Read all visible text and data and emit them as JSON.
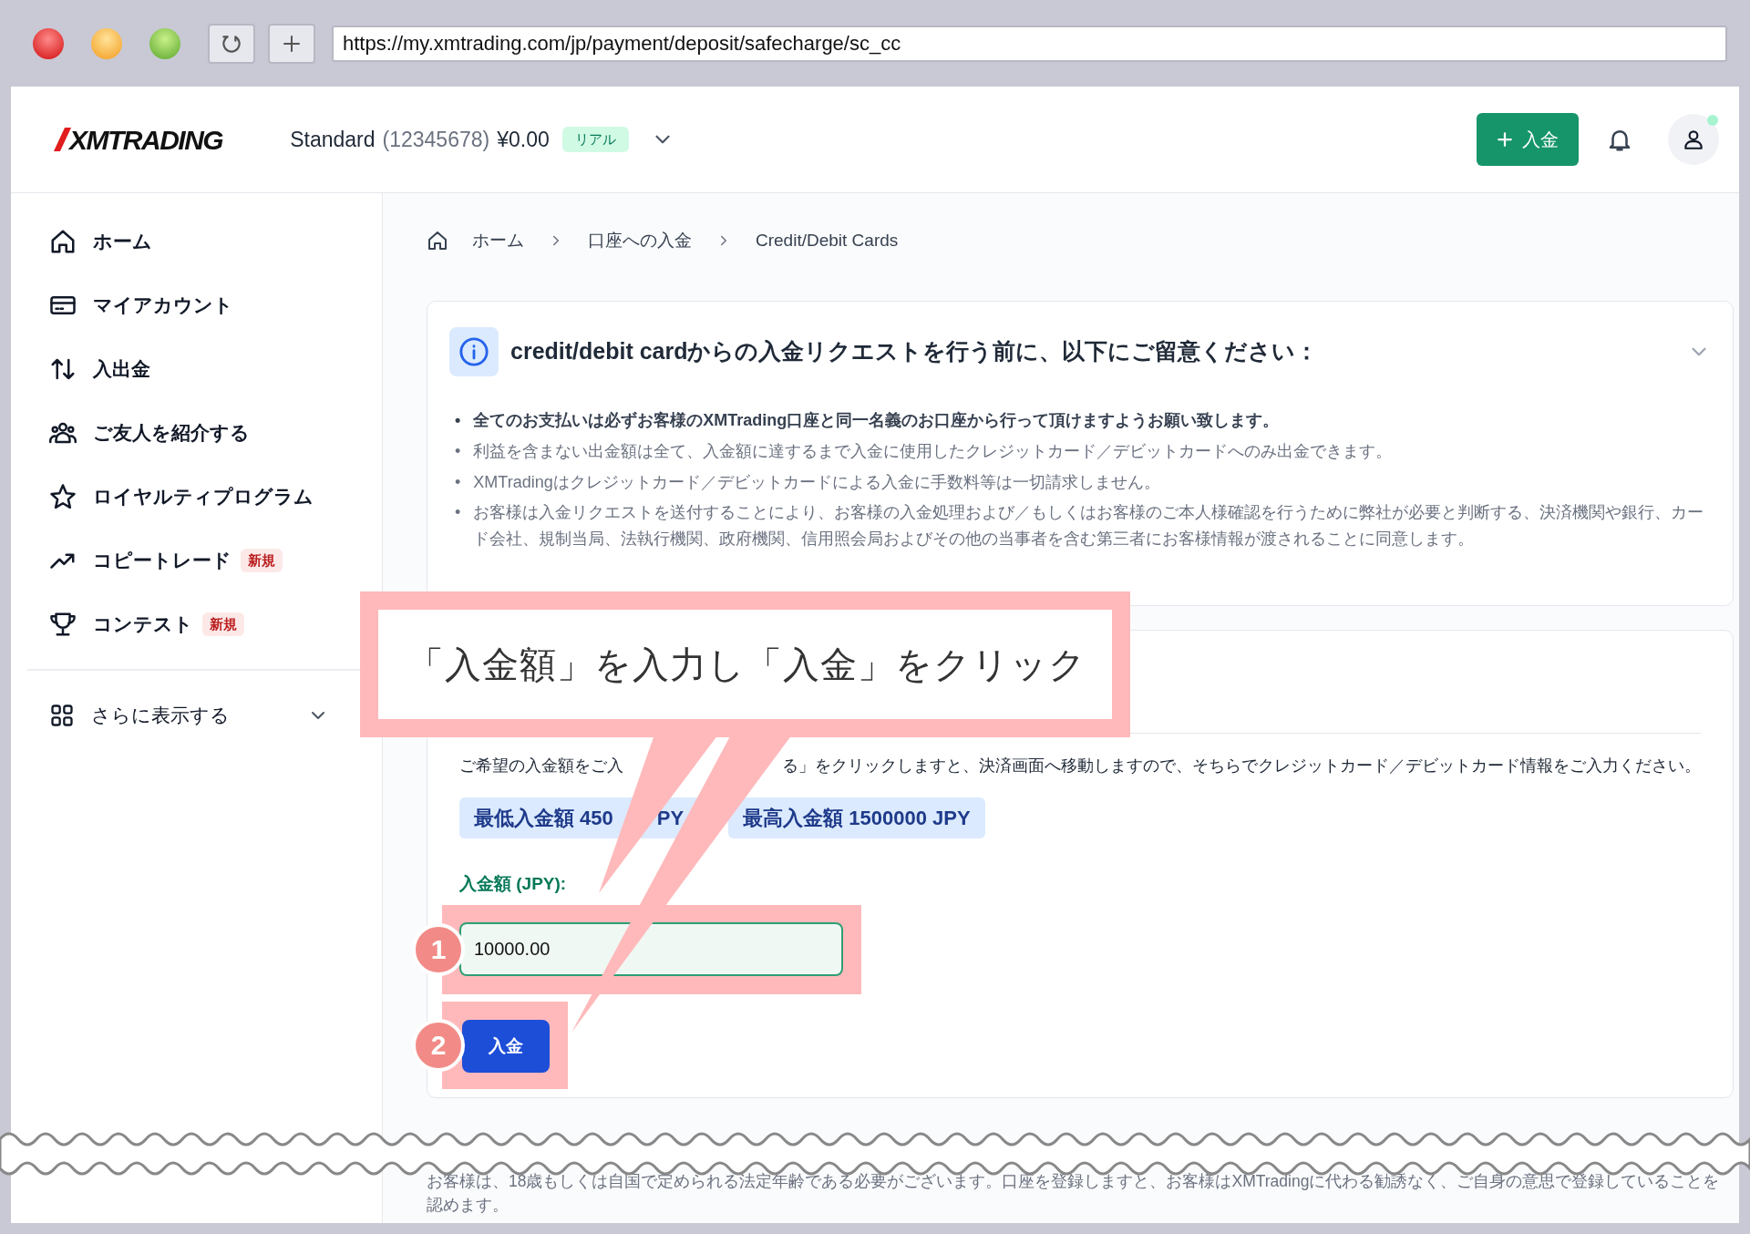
{
  "browser": {
    "url": "https://my.xmtrading.com/jp/payment/deposit/safecharge/sc_cc"
  },
  "header": {
    "logo": "XMTRADING",
    "account_type": "Standard",
    "account_number": "(12345678)",
    "balance": "¥0.00",
    "account_badge": "リアル",
    "deposit_button": "入金"
  },
  "sidebar": {
    "items": [
      {
        "label": "ホーム",
        "selected": false
      },
      {
        "label": "マイアカウント",
        "selected": false
      },
      {
        "label": "入出金",
        "selected": false
      },
      {
        "label": "ご友人を紹介する",
        "selected": false
      },
      {
        "label": "ロイヤルティプログラム",
        "selected": false
      },
      {
        "label": "コピートレード",
        "selected": false,
        "badge": "新規"
      },
      {
        "label": "コンテスト",
        "selected": false,
        "badge": "新規"
      }
    ],
    "more": {
      "label": "さらに表示する",
      "expanded": false
    }
  },
  "breadcrumb": [
    "ホーム",
    "口座への入金",
    "Credit/Debit Cards"
  ],
  "notice": {
    "title": "credit/debit cardからの入金リクエストを行う前に、以下にご留意ください：",
    "expanded": true,
    "items": [
      {
        "marker": "•",
        "text": "全てのお支払いは必ずお客様のXMTrading口座と同一名義のお口座から行って頂けますようお願い致します。",
        "bold": true
      },
      {
        "marker": "•",
        "text": "利益を含まない出金額は全て、入金額に達するまで入金に使用したクレジットカード／デビットカードへのみ出金できます。",
        "bold": false
      },
      {
        "marker": "•",
        "text": "XMTradingはクレジットカード／デビットカードによる入金に手数料等は一切請求しません。",
        "bold": false
      },
      {
        "marker": "•",
        "text": "お客様は入金リクエストを送付することにより、お客様の入金処理および／もしくはお客様のご本人様確認を行うために弊社が必要と判断する、決済機関や銀行、カード会社、規制当局、法執行機関、政府機関、信用照会局およびその他の当事者を含む第三者にお客様情報が渡されることに同意します。",
        "bold": false
      }
    ]
  },
  "deposit_form": {
    "intro": [
      "ご希望の入金額をご入",
      "る」をクリックしますと、決済画面へ移動しますので、そちらでクレジットカード／デビットカード情報をご入力ください。"
    ],
    "limits": [
      [
        "最低入金額 450",
        "PY"
      ],
      [
        "最高入金額 1500000 JPY"
      ]
    ],
    "amount_label": "入金額 (JPY):",
    "amount_value": "10000.00",
    "submit_button": "入金"
  },
  "callout": {
    "text": "「入金額」を入力し「入金」をクリック",
    "steps": [
      "1",
      "2"
    ]
  },
  "footer": "お客様は、18歳もしくは自国で定められる法定年齢である必要がございます。口座を登録しますと、お客様はXMTradingに代わる勧誘なく、ご自身の意思で登録していることを認めます。"
}
